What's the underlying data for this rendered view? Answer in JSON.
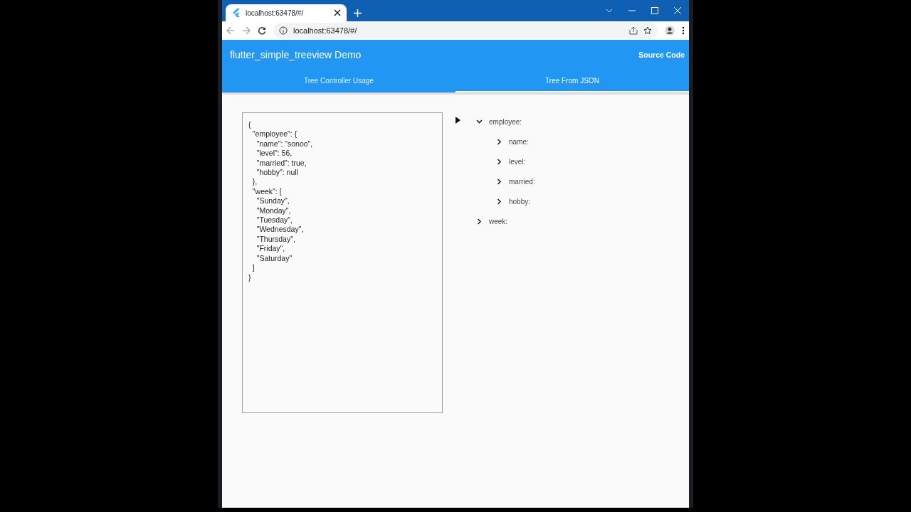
{
  "browser": {
    "tab": {
      "title": "localhost:63478/#/"
    },
    "address": "localhost:63478/#/"
  },
  "app_bar": {
    "title": "flutter_simple_treeview Demo",
    "action": "Source Code",
    "tabs": [
      {
        "label": "Tree Controller Usage",
        "selected": false
      },
      {
        "label": "Tree From JSON",
        "selected": true
      }
    ]
  },
  "editor": {
    "value": "{\n  \"employee\": {\n    \"name\": \"sonoo\",\n    \"level\": 56,\n    \"married\": true,\n    \"hobby\": null\n  },\n  \"week\": [\n    \"Sunday\",\n    \"Monday\",\n    \"Tuesday\",\n    \"Wednesday\",\n    \"Thursday\",\n    \"Friday\",\n    \"Saturday\"\n  ]\n}"
  },
  "tree": {
    "nodes": [
      {
        "label": "employee:",
        "expanded": true,
        "children": [
          {
            "label": "name:",
            "expanded": false
          },
          {
            "label": "level:",
            "expanded": false
          },
          {
            "label": "married:",
            "expanded": false
          },
          {
            "label": "hobby:",
            "expanded": false
          }
        ]
      },
      {
        "label": "week:",
        "expanded": false
      }
    ]
  }
}
